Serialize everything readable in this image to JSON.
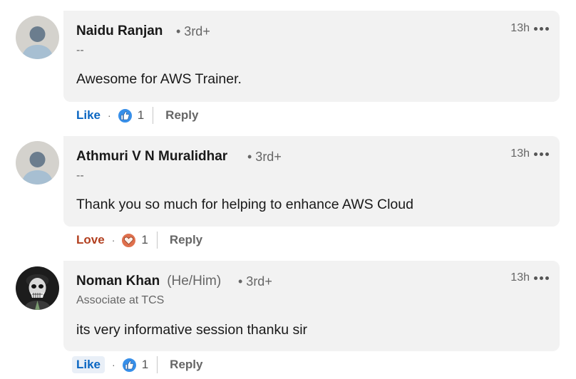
{
  "comments": [
    {
      "name": "Naidu Ranjan",
      "pronouns": "",
      "degree": "• 3rd+",
      "subtitle": "--",
      "time": "13h",
      "text": "Awesome for AWS Trainer.",
      "reaction_label": "Like",
      "reaction_icon": "thumbs-up-icon",
      "reaction_count": "1",
      "reply_label": "Reply"
    },
    {
      "name": "Athmuri V N Muralidhar",
      "pronouns": "",
      "degree": "• 3rd+",
      "subtitle": "--",
      "time": "13h",
      "text": "Thank you so much for helping to enhance AWS Cloud",
      "reaction_label": "Love",
      "reaction_icon": "heart-icon",
      "reaction_count": "1",
      "reply_label": "Reply"
    },
    {
      "name": "Noman Khan",
      "pronouns": "(He/Him)",
      "degree": "• 3rd+",
      "subtitle": "Associate at TCS",
      "time": "13h",
      "text": "its very informative session thanku sir",
      "reaction_label": "Like",
      "reaction_icon": "thumbs-up-icon",
      "reaction_count": "1",
      "reply_label": "Reply"
    }
  ],
  "separator": "·",
  "colors": {
    "bubble": "#f2f2f2",
    "like_blue": "#0a66c2",
    "love_red": "#b24020",
    "meta_gray": "#666666"
  }
}
